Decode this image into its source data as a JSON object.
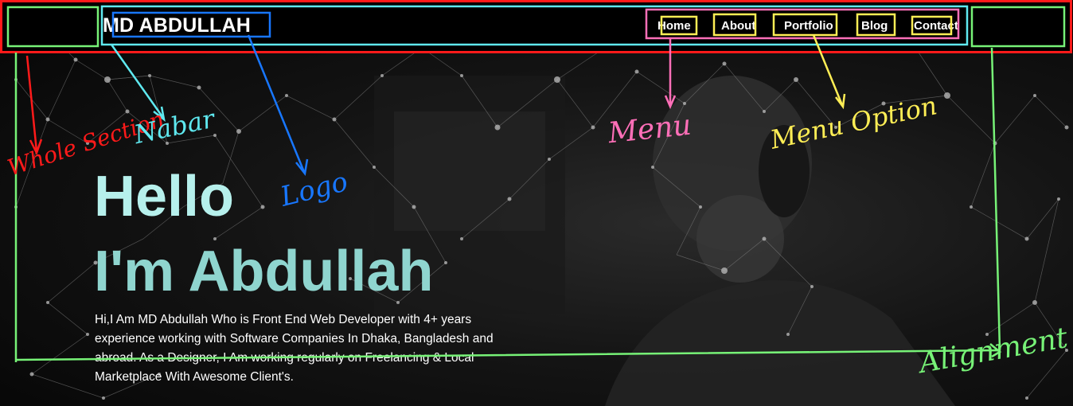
{
  "header": {
    "logo": "MD ABDULLAH",
    "menu": [
      "Home",
      "About",
      "Portfolio",
      "Blog",
      "Contact"
    ]
  },
  "hero": {
    "title_line1": "Hello",
    "title_line2": "I'm Abdullah",
    "description": "Hi,I Am MD Abdullah Who is Front End Web Developer with 4+ years experience working with Software Companies In Dhaka, Bangladesh and abroad. As a Designer, I Am working regularly on Freelancing & Local Marketplace With Awesome Client's."
  },
  "annotations": {
    "whole_section": "Whole Section",
    "navbar": "Nabar",
    "logo": "Logo",
    "menu": "Menu",
    "menu_option": "Menu Option",
    "alignment": "Alignment"
  },
  "colors": {
    "hero_title": "#9fe3df",
    "whole_section": "#ff1a1a",
    "navbar": "#5fe9f0",
    "logo": "#1877ff",
    "menu": "#ff6fb8",
    "menu_option": "#ffee55",
    "alignment": "#77f277"
  }
}
